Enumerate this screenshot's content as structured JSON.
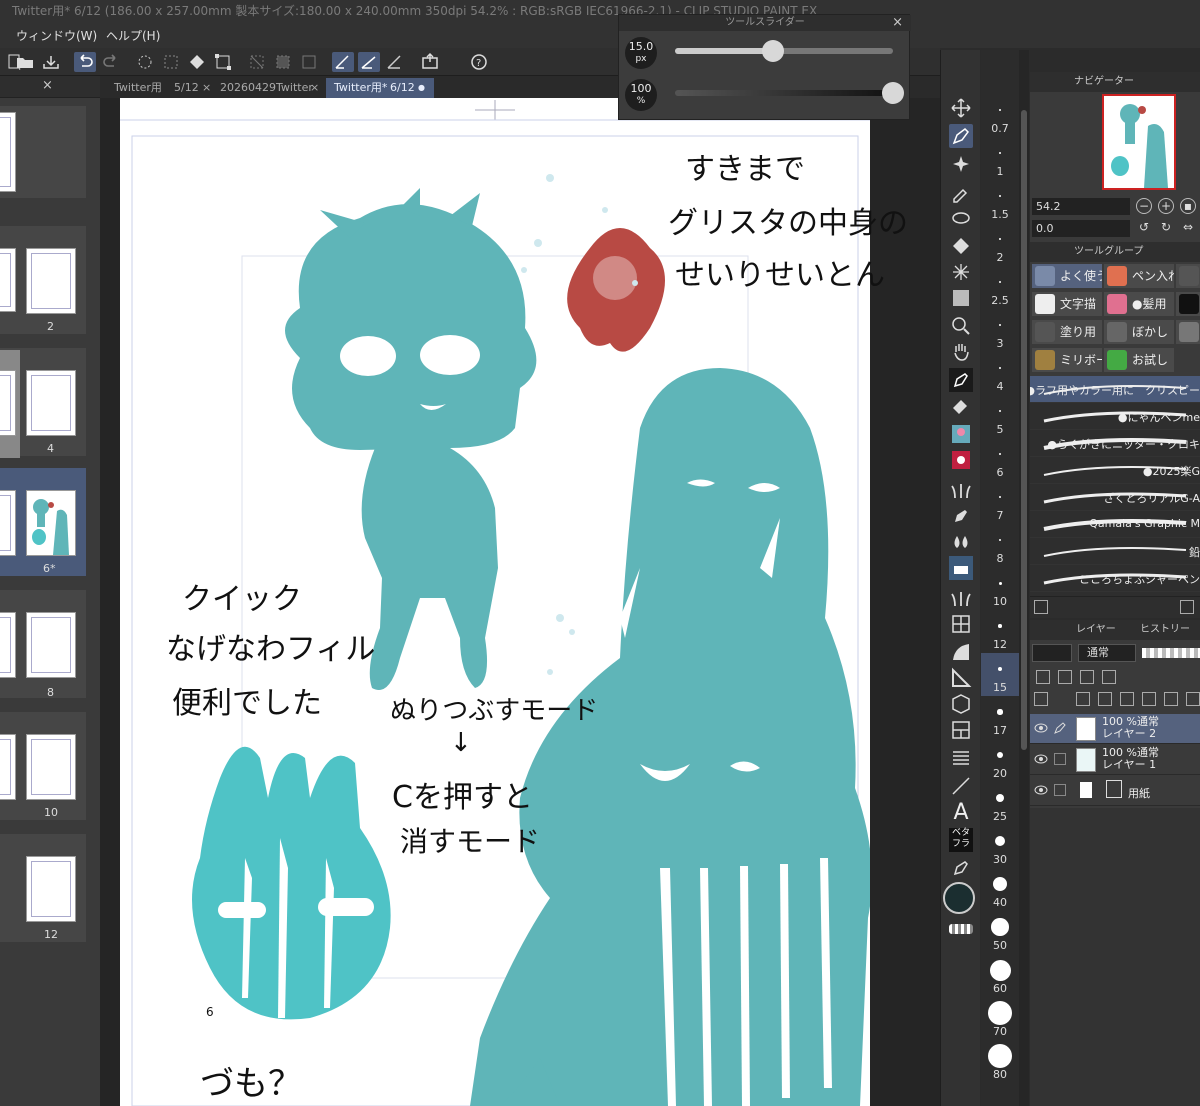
{
  "window": {
    "title": "Twitter用* 6/12 (186.00 x 257.00mm 製本サイズ:180.00 x 240.00mm 350dpi 54.2% : RGB:sRGB IEC61966-2.1) - CLIP STUDIO PAINT EX"
  },
  "menu": {
    "window": "ウィンドウ(W)",
    "help": "ヘルプ(H)"
  },
  "tabs": [
    {
      "label": "Twitter用",
      "page": "5/12",
      "close": "×"
    },
    {
      "label": "20260429Twitter",
      "close": "×"
    },
    {
      "label": "Twitter用*",
      "page": "6/12",
      "close": "●"
    }
  ],
  "page_manager": {
    "close": "×",
    "pages": [
      "2",
      "4",
      "6*",
      "8",
      "10",
      "12"
    ]
  },
  "canvas": {
    "page_number": "6"
  },
  "handwriting": {
    "top_right": [
      "すきまで",
      "グリスタの中身の",
      "せいりせいとん"
    ],
    "left": [
      "クイック",
      "なげなわフィル",
      "便利でした"
    ],
    "fill_mode": "ぬりつぶすモード",
    "arrow": "↓",
    "erase_mode": [
      "Cを押すと",
      "消すモード"
    ],
    "bottom": "づも？"
  },
  "tool_slider": {
    "title": "ツールスライダー",
    "close": "×",
    "size_value": "15.0",
    "size_unit": "px",
    "size_fraction": 0.45,
    "opacity_value": "100",
    "opacity_unit": "%",
    "opacity_fraction": 1.0
  },
  "brush_sizes": [
    "0.7",
    "1",
    "1.5",
    "2",
    "2.5",
    "3",
    "4",
    "5",
    "6",
    "7",
    "8",
    "10",
    "12",
    "15",
    "17",
    "20",
    "25",
    "30",
    "40",
    "50",
    "60",
    "70",
    "80"
  ],
  "brush_size_selected": "15",
  "navigator": {
    "title": "ナビゲーター",
    "zoom": "54.2",
    "rotation": "0.0"
  },
  "tool_group": {
    "title": "ツールグループ",
    "buttons": [
      [
        "よく使う",
        "ペン入れ",
        ""
      ],
      [
        "文字描",
        "●髪用",
        ""
      ],
      [
        "塗り用",
        "ぼかし",
        ""
      ],
      [
        "ミリボー",
        "お試し",
        ""
      ]
    ]
  },
  "brushes": [
    "●ラフ用やカラー用に　クリスピー",
    "●にゃんペンme",
    "●らくがきにニッター・クロキ",
    "●2025楽G",
    "ざくとろリアルG-A",
    "Qamala's Graphic M",
    "鉛",
    "こころちょふシャーペン"
  ],
  "layers_panel": {
    "tab_layer": "レイヤー",
    "tab_history": "ヒストリー",
    "blend_mode": "通常",
    "layers": [
      {
        "line1": "100 %通常",
        "line2": "レイヤー 2",
        "selected": true
      },
      {
        "line1": "100 %通常",
        "line2": "レイヤー 1",
        "selected": false
      },
      {
        "line1": "",
        "line2": "用紙",
        "selected": false
      }
    ]
  },
  "colors": {
    "teal": "#5fb5b8",
    "teal_light": "#4fc3c6",
    "red": "#b84a44",
    "accent": "#4a5a7a"
  },
  "tool_labels": {
    "beta_fill": "ベタ\nフラ",
    "text_tool": "A"
  }
}
